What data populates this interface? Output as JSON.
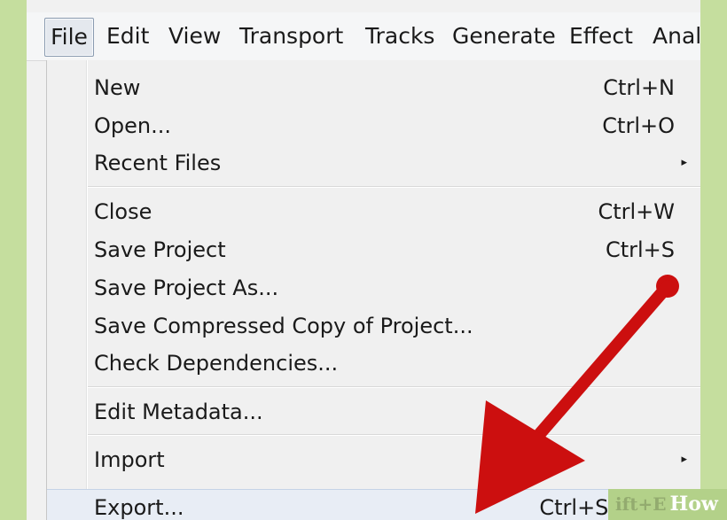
{
  "menubar": {
    "items": [
      "File",
      "Edit",
      "View",
      "Transport",
      "Tracks",
      "Generate",
      "Effect",
      "Anal"
    ]
  },
  "file_menu": {
    "items": [
      {
        "label": "New",
        "shortcut": "Ctrl+N"
      },
      {
        "label": "Open...",
        "shortcut": "Ctrl+O"
      },
      {
        "label": "Recent Files"
      },
      {
        "label": "Close",
        "shortcut": "Ctrl+W"
      },
      {
        "label": "Save Project",
        "shortcut": "Ctrl+S"
      },
      {
        "label": "Save Project As..."
      },
      {
        "label": "Save Compressed Copy of Project..."
      },
      {
        "label": "Check Dependencies..."
      },
      {
        "label": "Edit Metadata..."
      },
      {
        "label": "Import"
      },
      {
        "label": "Export...",
        "shortcut": "Ctrl+Shift+E"
      }
    ],
    "submenu_glyph": "▸"
  },
  "annotation": {
    "arrow_color": "#cc0f0f",
    "icon": "red-arrow-icon"
  },
  "watermark": {
    "text": "How",
    "ghost_text": "ift+E"
  },
  "colors": {
    "background": "#c5de9e",
    "menu_background": "#f0f0f0",
    "highlight": "#e8edf5"
  }
}
